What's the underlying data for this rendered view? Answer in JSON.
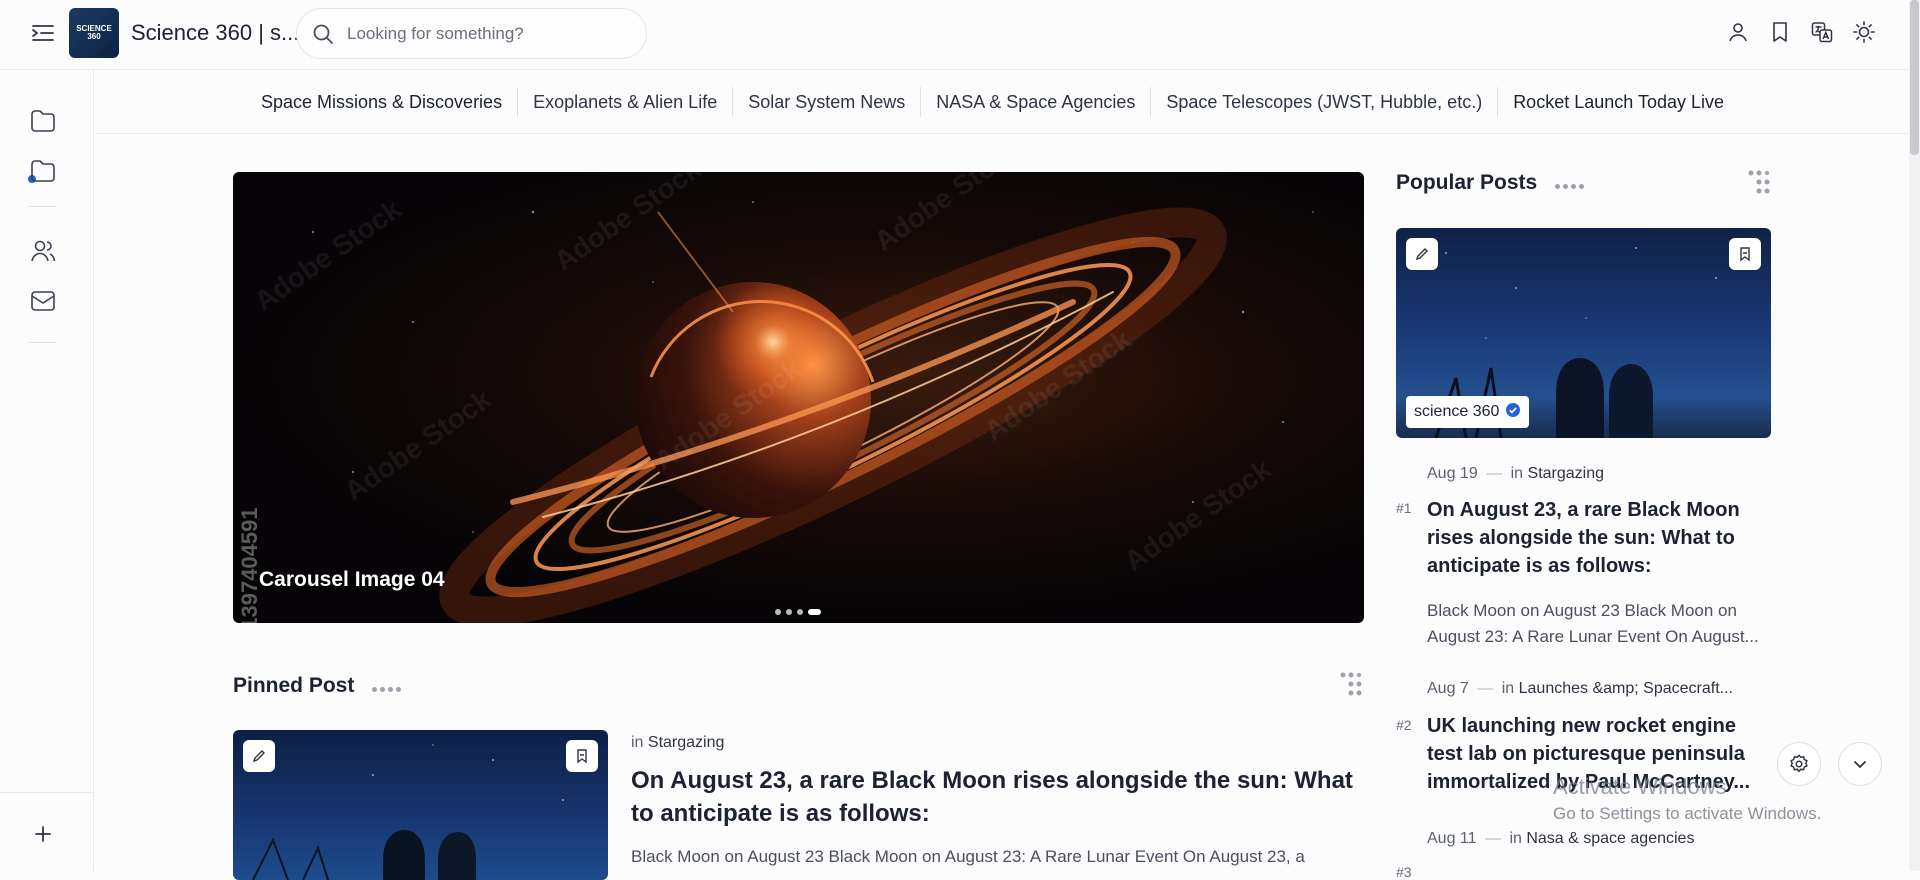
{
  "header": {
    "site_title": "Science 360 | s...",
    "logo_text": "SCIENCE 360",
    "search_placeholder": "Looking for something?"
  },
  "categories": [
    "Space Missions & Discoveries",
    "Exoplanets & Alien Life",
    "Solar System News",
    "NASA & Space Agencies",
    "Space Telescopes (JWST, Hubble, etc.)",
    "Rocket Launch Today Live"
  ],
  "hero": {
    "caption": "Carousel Image 04",
    "watermark_id": "#1397404591",
    "watermark_text": "Adobe Stock",
    "slide_count": 4,
    "active_slide": 4
  },
  "pinned": {
    "heading": "Pinned Post",
    "category_prefix": "in",
    "category": "Stargazing",
    "title": "On August 23, a rare Black Moon rises alongside the sun: What to anticipate is as follows:",
    "excerpt": "Black Moon on August 23 Black Moon on August 23: A Rare Lunar Event On August 23, a"
  },
  "popular": {
    "heading": "Popular Posts",
    "author_chip": "science 360",
    "posts": [
      {
        "rank": "#1",
        "date": "Aug 19",
        "separator": "—",
        "category_prefix": "in",
        "category": "Stargazing",
        "title": "On August 23, a rare Black Moon rises alongside the sun: What to anticipate is as follows:",
        "excerpt": "Black Moon on August 23 Black Moon on August 23: A Rare Lunar Event On August..."
      },
      {
        "rank": "#2",
        "date": "Aug 7",
        "separator": "—",
        "category_prefix": "in",
        "category": "Launches &amp; Spacecraft...",
        "title": "UK launching new rocket engine test lab on picturesque peninsula immortalized by Paul McCartney...",
        "excerpt": ""
      },
      {
        "rank": "#3",
        "date": "Aug 11",
        "separator": "—",
        "category_prefix": "in",
        "category": "Nasa & space agencies",
        "title": "",
        "excerpt": ""
      }
    ]
  },
  "system_overlay": {
    "activate_title": "Activate Windows",
    "activate_sub": "Go to Settings to activate Windows."
  },
  "icons": {
    "menu": "menu-collapse-icon",
    "search": "search-icon",
    "user": "user-icon",
    "bookmark": "bookmark-icon",
    "translate": "translate-icon",
    "theme": "sun-icon",
    "settings": "gear-icon",
    "scroll_down": "chevron-down-icon",
    "edit": "pencil-icon",
    "verified": "verified-badge-icon"
  },
  "colors": {
    "accent": "#2563d8",
    "text": "#1c2230",
    "border": "#e8e9ee"
  }
}
